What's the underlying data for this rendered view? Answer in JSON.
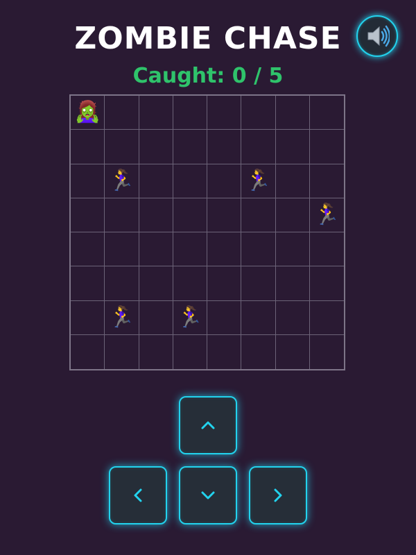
{
  "header": {
    "title": "ZOMBIE CHASE",
    "score_text": "Caught: 0 / 5"
  },
  "sound_button": {
    "icon": "speaker-icon"
  },
  "board": {
    "rows": 8,
    "cols": 8,
    "zombie": {
      "row": 0,
      "col": 0,
      "icon": "zombie-icon"
    },
    "humans": [
      {
        "row": 2,
        "col": 1,
        "icon": "running-woman-icon"
      },
      {
        "row": 2,
        "col": 5,
        "icon": "running-woman-icon"
      },
      {
        "row": 3,
        "col": 7,
        "icon": "running-woman-icon"
      },
      {
        "row": 6,
        "col": 1,
        "icon": "running-woman-icon"
      },
      {
        "row": 6,
        "col": 3,
        "icon": "running-woman-icon"
      }
    ]
  },
  "controls": {
    "up": "chevron-up-icon",
    "left": "chevron-left-icon",
    "down": "chevron-down-icon",
    "right": "chevron-right-icon"
  },
  "colors": {
    "background": "#2a1a33",
    "accent": "#22d3ee",
    "score": "#2fc36b",
    "grid_line": "#6c6378"
  }
}
